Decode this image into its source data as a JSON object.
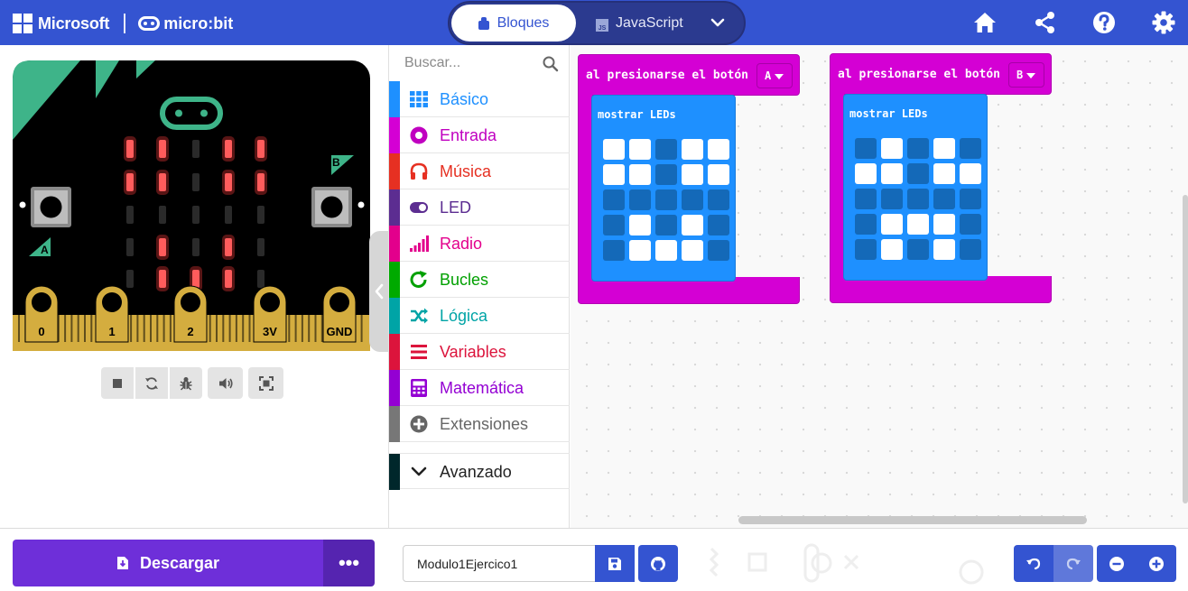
{
  "header": {
    "brand_ms": "Microsoft",
    "brand_microbit": "micro:bit",
    "tab_blocks": "Bloques",
    "tab_js": "JavaScript",
    "js_badge": "JS",
    "icons": [
      "home-icon",
      "share-icon",
      "help-icon",
      "settings-icon"
    ]
  },
  "simulator": {
    "pins": [
      "0",
      "1",
      "2",
      "3V",
      "GND"
    ],
    "button_a": "A",
    "button_b": "B",
    "leds": [
      [
        1,
        1,
        0,
        1,
        1
      ],
      [
        1,
        1,
        0,
        1,
        1
      ],
      [
        0,
        0,
        0,
        0,
        0
      ],
      [
        0,
        1,
        0,
        1,
        0
      ],
      [
        0,
        1,
        1,
        1,
        0
      ]
    ],
    "controls": [
      "stop-icon",
      "restart-icon",
      "debug-icon",
      "sound-icon",
      "fullscreen-icon"
    ]
  },
  "toolbox": {
    "search_placeholder": "Buscar...",
    "categories": [
      {
        "label": "Básico",
        "color": "#1e90ff",
        "text_color": "#1e90ff"
      },
      {
        "label": "Entrada",
        "color": "#d400d4",
        "text_color": "#c000c0"
      },
      {
        "label": "Música",
        "color": "#e63022",
        "text_color": "#e63022"
      },
      {
        "label": "LED",
        "color": "#5c2d91",
        "text_color": "#5c2d91"
      },
      {
        "label": "Radio",
        "color": "#e3008c",
        "text_color": "#e3008c"
      },
      {
        "label": "Bucles",
        "color": "#00aa00",
        "text_color": "#00a000"
      },
      {
        "label": "Lógica",
        "color": "#00a4a6",
        "text_color": "#00a4a6"
      },
      {
        "label": "Variables",
        "color": "#dc143c",
        "text_color": "#dc143c"
      },
      {
        "label": "Matemática",
        "color": "#9400d3",
        "text_color": "#9400d3"
      },
      {
        "label": "Extensiones",
        "color": "#777777",
        "text_color": "#666666"
      }
    ],
    "advanced": {
      "label": "Avanzado",
      "color": "#00272b"
    }
  },
  "workspace": {
    "blocks": [
      {
        "event_text": "al presionarse el botón",
        "button": "A",
        "inner_title": "mostrar LEDs",
        "leds": [
          [
            1,
            1,
            0,
            1,
            1
          ],
          [
            1,
            1,
            0,
            1,
            1
          ],
          [
            0,
            0,
            0,
            0,
            0
          ],
          [
            0,
            1,
            0,
            1,
            0
          ],
          [
            0,
            1,
            1,
            1,
            0
          ]
        ]
      },
      {
        "event_text": "al presionarse el botón",
        "button": "B",
        "inner_title": "mostrar LEDs",
        "leds": [
          [
            0,
            1,
            0,
            1,
            0
          ],
          [
            1,
            1,
            0,
            1,
            1
          ],
          [
            0,
            0,
            0,
            0,
            0
          ],
          [
            0,
            1,
            1,
            1,
            0
          ],
          [
            0,
            1,
            0,
            1,
            0
          ]
        ]
      }
    ]
  },
  "footer": {
    "download_label": "Descargar",
    "more_label": "•••",
    "project_name": "Modulo1Ejercico1",
    "icons": [
      "save-icon",
      "github-icon",
      "undo-icon",
      "redo-icon",
      "zoom-out-icon",
      "zoom-in-icon"
    ]
  },
  "colors": {
    "header": "#3454d1",
    "block_event": "#d400d4",
    "block_basic": "#1e90ff",
    "download": "#6e2fd9"
  }
}
